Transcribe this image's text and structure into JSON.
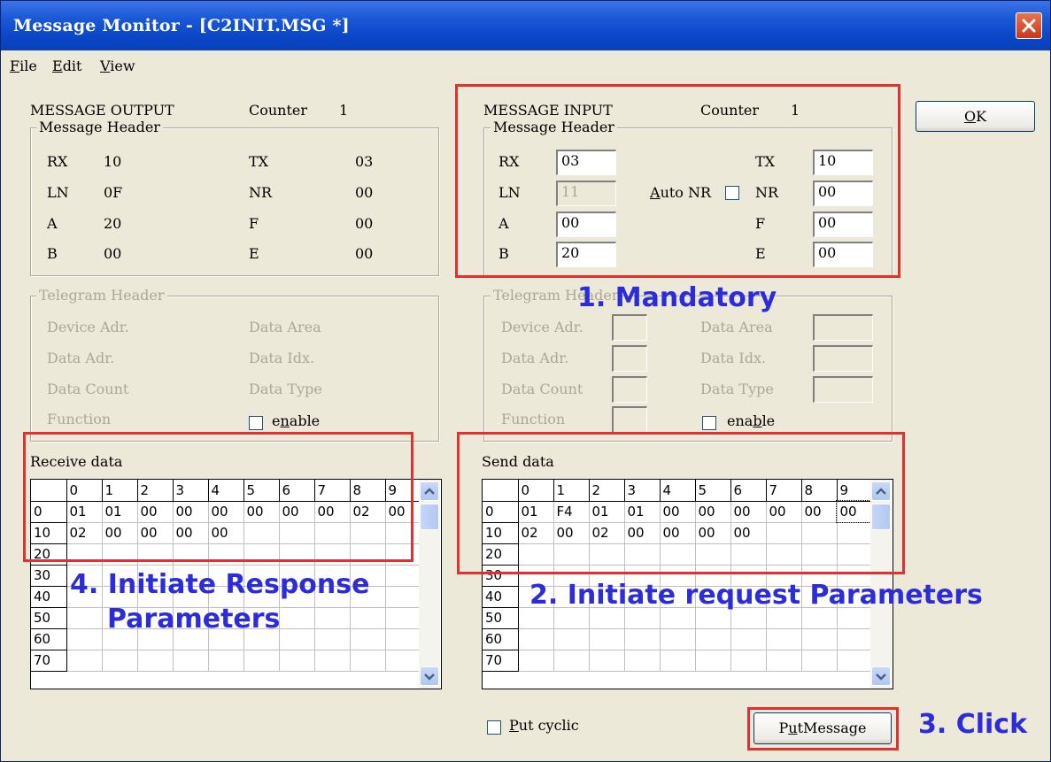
{
  "window": {
    "title": "Message Monitor - [C2INIT.MSG *]"
  },
  "menu": [
    {
      "key": "F",
      "rest": "ile"
    },
    {
      "key": "E",
      "rest": "dit"
    },
    {
      "key": "V",
      "rest": "iew"
    }
  ],
  "output": {
    "title": "MESSAGE OUTPUT",
    "counter_label": "Counter",
    "counter": "1",
    "header_legend": "Message Header",
    "rx_label": "RX",
    "rx": "10",
    "tx_label": "TX",
    "tx": "03",
    "ln_label": "LN",
    "ln": "0F",
    "nr_label": "NR",
    "nr": "00",
    "a_label": "A",
    "a": "20",
    "f_label": "F",
    "f": "00",
    "b_label": "B",
    "b": "00",
    "e_label": "E",
    "e": "00",
    "tel_legend": "Telegram Header",
    "device_adr": "Device Adr.",
    "data_area": "Data Area",
    "data_adr": "Data Adr.",
    "data_idx": "Data Idx.",
    "data_count": "Data Count",
    "data_type": "Data Type",
    "function": "Function",
    "enable_pre": "e",
    "enable_key": "n",
    "enable_post": "able",
    "data_label": "Receive data"
  },
  "input": {
    "title": "MESSAGE INPUT",
    "counter_label": "Counter",
    "counter": "1",
    "header_legend": "Message Header",
    "rx_label": "RX",
    "rx": "03",
    "tx_label": "TX",
    "tx": "10",
    "ln_label": "LN",
    "ln": "11",
    "auto_nr_key": "A",
    "auto_nr_rest": "uto NR",
    "nr_label": "NR",
    "nr": "00",
    "a_label": "A",
    "a": "00",
    "f_label": "F",
    "f": "00",
    "b_label": "B",
    "b": "20",
    "e_label": "E",
    "e": "00",
    "tel_legend": "Telegram Header",
    "device_adr": "Device Adr.",
    "data_area": "Data Area",
    "data_adr": "Data Adr.",
    "data_idx": "Data Idx.",
    "data_count": "Data Count",
    "data_type": "Data Type",
    "function": "Function",
    "enable_pre": "ena",
    "enable_key": "b",
    "enable_post": "le",
    "data_label": "Send data",
    "put_cyclic_key": "P",
    "put_cyclic_rest": "ut cyclic"
  },
  "grid_columns": [
    "0",
    "1",
    "2",
    "3",
    "4",
    "5",
    "6",
    "7",
    "8",
    "9"
  ],
  "receive_rows": [
    {
      "label": "0",
      "cells": [
        "01",
        "01",
        "00",
        "00",
        "00",
        "00",
        "00",
        "00",
        "02",
        "00"
      ]
    },
    {
      "label": "10",
      "cells": [
        "02",
        "00",
        "00",
        "00",
        "00",
        "",
        "",
        "",
        "",
        ""
      ]
    },
    {
      "label": "20",
      "cells": [
        "",
        "",
        "",
        "",
        "",
        "",
        "",
        "",
        "",
        ""
      ]
    },
    {
      "label": "30",
      "cells": [
        "",
        "",
        "",
        "",
        "",
        "",
        "",
        "",
        "",
        ""
      ]
    },
    {
      "label": "40",
      "cells": [
        "",
        "",
        "",
        "",
        "",
        "",
        "",
        "",
        "",
        ""
      ]
    },
    {
      "label": "50",
      "cells": [
        "",
        "",
        "",
        "",
        "",
        "",
        "",
        "",
        "",
        ""
      ]
    },
    {
      "label": "60",
      "cells": [
        "",
        "",
        "",
        "",
        "",
        "",
        "",
        "",
        "",
        ""
      ]
    },
    {
      "label": "70",
      "cells": [
        "",
        "",
        "",
        "",
        "",
        "",
        "",
        "",
        "",
        ""
      ]
    }
  ],
  "send_rows": [
    {
      "label": "0",
      "cells": [
        "01",
        "F4",
        "01",
        "01",
        "00",
        "00",
        "00",
        "00",
        "00",
        "00"
      ]
    },
    {
      "label": "10",
      "cells": [
        "02",
        "00",
        "02",
        "00",
        "00",
        "00",
        "00",
        "",
        "",
        ""
      ]
    },
    {
      "label": "20",
      "cells": [
        "",
        "",
        "",
        "",
        "",
        "",
        "",
        "",
        "",
        ""
      ]
    },
    {
      "label": "30",
      "cells": [
        "",
        "",
        "",
        "",
        "",
        "",
        "",
        "",
        "",
        ""
      ]
    },
    {
      "label": "40",
      "cells": [
        "",
        "",
        "",
        "",
        "",
        "",
        "",
        "",
        "",
        ""
      ]
    },
    {
      "label": "50",
      "cells": [
        "",
        "",
        "",
        "",
        "",
        "",
        "",
        "",
        "",
        ""
      ]
    },
    {
      "label": "60",
      "cells": [
        "",
        "",
        "",
        "",
        "",
        "",
        "",
        "",
        "",
        ""
      ]
    },
    {
      "label": "70",
      "cells": [
        "",
        "",
        "",
        "",
        "",
        "",
        "",
        "",
        "",
        ""
      ]
    }
  ],
  "buttons": {
    "ok_key": "O",
    "ok_rest": "K",
    "put_pre": "P",
    "put_key": "u",
    "put_rest": "tMessage"
  },
  "annotations": {
    "mandatory": "1. Mandatory",
    "initiate_request": "2. Initiate request Parameters",
    "click": "3. Click",
    "initiate_response_1": "4. Initiate Response",
    "initiate_response_2": "Parameters"
  },
  "colors": {
    "annotation": "#2c2cd8",
    "highlight_box": "#e03030",
    "titlebar": "#0a48c8"
  }
}
